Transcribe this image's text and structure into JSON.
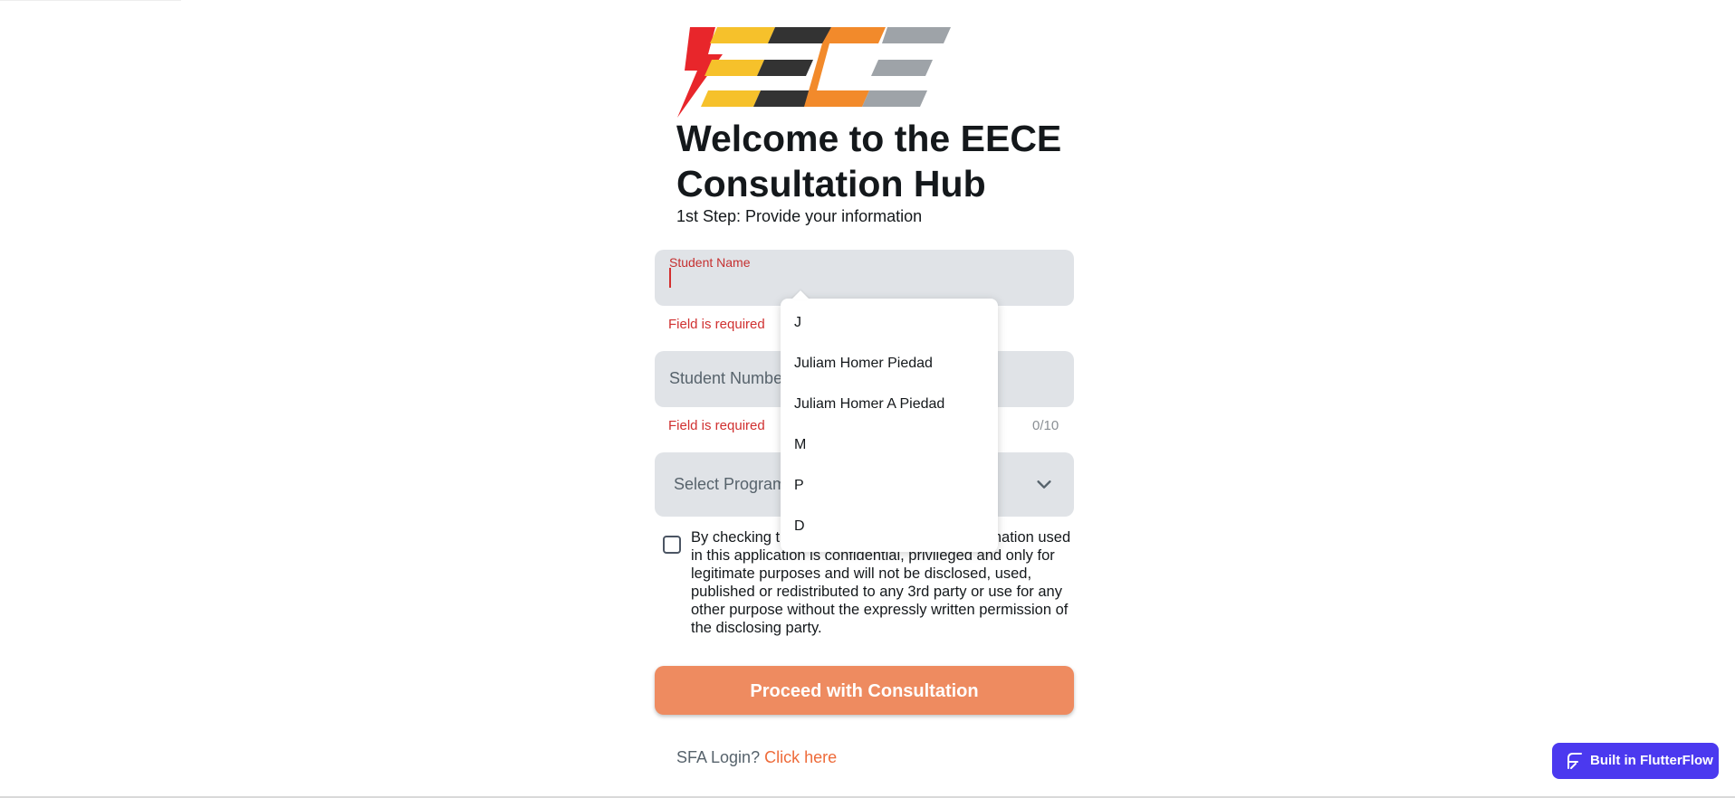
{
  "header": {
    "logo_text": "EECE",
    "title": "Welcome to the EECE Consultation Hub",
    "subtitle": "1st Step: Provide your information"
  },
  "form": {
    "student_name_label": "Student Name",
    "student_name_value": "",
    "student_name_error": "Field is required",
    "student_number_placeholder": "Student Number",
    "student_number_error": "Field is required",
    "student_number_counter": "0/10",
    "program_placeholder": "Select Program",
    "terms_text": "By checking this box, you agree that the information used in this application is confidential, privileged and only for legitimate purposes and will not be disclosed, used, published or redistributed to any 3rd party or use for any other purpose without the expressly written permission of the disclosing party.",
    "terms_checked": false,
    "proceed_label": "Proceed with Consultation"
  },
  "autocomplete": {
    "options": [
      "J",
      "Juliam Homer Piedad",
      "Juliam Homer A Piedad",
      "M",
      "P",
      "D"
    ]
  },
  "footer": {
    "sfa_prefix": "SFA Login?",
    "sfa_link": "Click here"
  },
  "badge": {
    "label": "Built in FlutterFlow"
  },
  "colors": {
    "primary": "#ee8b60",
    "error": "#d03030",
    "field_bg": "#e0e3e7",
    "badge_bg": "#4b39ef",
    "link": "#ee6b3a"
  },
  "icons": {
    "dropdown": "chevron-down-icon",
    "badge": "flutterflow-icon",
    "logo": "eece-logo"
  }
}
